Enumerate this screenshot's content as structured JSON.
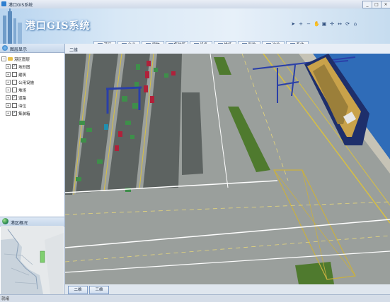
{
  "window": {
    "title": "港口GIS系统",
    "buttons": [
      "_",
      "□",
      "×"
    ]
  },
  "banner": {
    "app_title": "港口GIS系统",
    "toolbar_icons": [
      "select-icon",
      "zoom-in-icon",
      "zoom-out-icon",
      "pan-icon",
      "layers-icon",
      "center-icon",
      "measure-icon",
      "refresh-icon",
      "home-icon"
    ]
  },
  "menu": [
    {
      "label": "港区"
    },
    {
      "label": "企业"
    },
    {
      "label": "货物"
    },
    {
      "label": "集装箱"
    },
    {
      "label": "设备"
    },
    {
      "label": "堆场"
    },
    {
      "label": "船舶"
    },
    {
      "label": "泊位"
    },
    {
      "label": "系统"
    }
  ],
  "left_panel": {
    "title": "图层显示",
    "tree_root": "港区图层",
    "layers": [
      {
        "label": "地形图",
        "checked": true
      },
      {
        "label": "建筑",
        "checked": false
      },
      {
        "label": "公用设施",
        "checked": false
      },
      {
        "label": "堆场",
        "checked": false
      },
      {
        "label": "道路",
        "checked": true
      },
      {
        "label": "泊位",
        "checked": false
      },
      {
        "label": "集装箱",
        "checked": true
      }
    ],
    "overview_title": "港区概况"
  },
  "main": {
    "tab_label": "二维"
  },
  "bottom_buttons": [
    "二维",
    "三维"
  ],
  "status": {
    "text": "就绪"
  },
  "colors": {
    "accent": "#2f7fd0",
    "sea": "#2f6cb8",
    "crane": "#2a3fa8"
  }
}
